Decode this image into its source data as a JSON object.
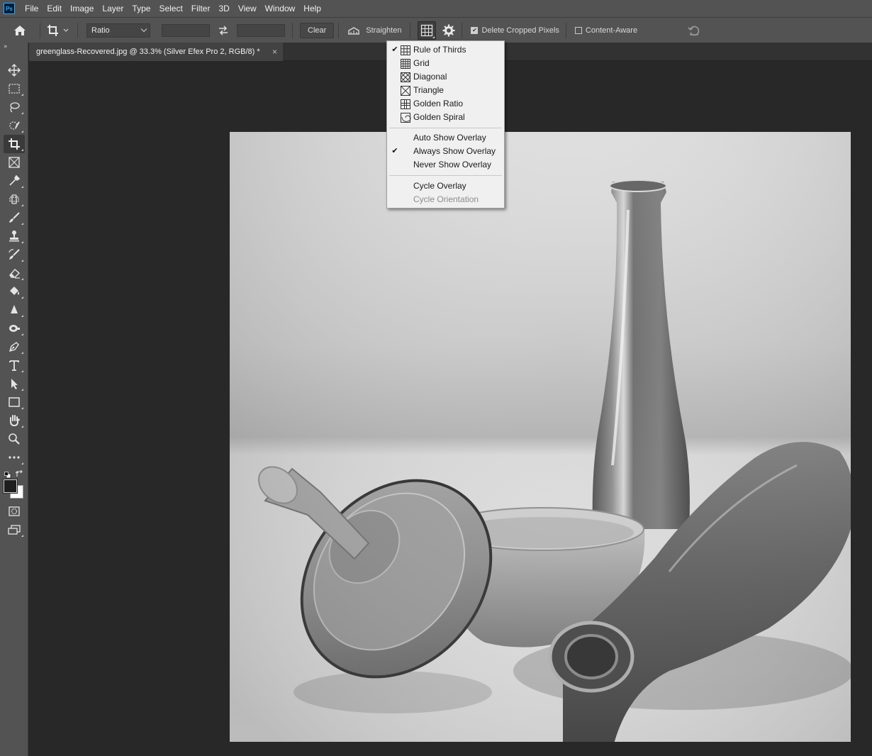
{
  "app": {
    "logo_text": "Ps"
  },
  "menu": [
    "File",
    "Edit",
    "Image",
    "Layer",
    "Type",
    "Select",
    "Filter",
    "3D",
    "View",
    "Window",
    "Help"
  ],
  "options": {
    "ratio_value": "Ratio",
    "clear_label": "Clear",
    "straighten_label": "Straighten",
    "delete_cropped_label": "Delete Cropped Pixels",
    "delete_cropped_checked": true,
    "content_aware_label": "Content-Aware",
    "content_aware_checked": false
  },
  "document": {
    "tab_title": "greenglass-Recovered.jpg @ 33.3% (Silver Efex Pro 2, RGB/8) *",
    "close_glyph": "×"
  },
  "overlay_menu": {
    "overlays": [
      {
        "label": "Rule of Thirds",
        "checked": true,
        "icon": "rule-of-thirds-icon"
      },
      {
        "label": "Grid",
        "checked": false,
        "icon": "grid-icon"
      },
      {
        "label": "Diagonal",
        "checked": false,
        "icon": "diagonal-icon"
      },
      {
        "label": "Triangle",
        "checked": false,
        "icon": "triangle-icon"
      },
      {
        "label": "Golden Ratio",
        "checked": false,
        "icon": "golden-ratio-icon"
      },
      {
        "label": "Golden Spiral",
        "checked": false,
        "icon": "golden-spiral-icon"
      }
    ],
    "show_modes": [
      {
        "label": "Auto Show Overlay",
        "checked": false
      },
      {
        "label": "Always Show Overlay",
        "checked": true
      },
      {
        "label": "Never Show Overlay",
        "checked": false
      }
    ],
    "cycle": [
      {
        "label": "Cycle Overlay",
        "enabled": true
      },
      {
        "label": "Cycle Orientation",
        "enabled": false
      }
    ]
  },
  "tools": [
    "move-tool",
    "marquee-tool",
    "lasso-tool",
    "quick-selection-tool",
    "crop-tool",
    "frame-tool",
    "eyedropper-tool",
    "healing-brush-tool",
    "brush-tool",
    "clone-stamp-tool",
    "history-brush-tool",
    "eraser-tool",
    "paint-bucket-tool",
    "blur-tool",
    "dodge-tool",
    "pen-tool",
    "type-tool",
    "path-selection-tool",
    "rectangle-tool",
    "hand-tool",
    "zoom-tool",
    "edit-toolbar"
  ],
  "colors": {
    "foreground": "#1e1e1e",
    "background": "#ffffff",
    "panel": "#535353",
    "canvas": "#282828"
  }
}
